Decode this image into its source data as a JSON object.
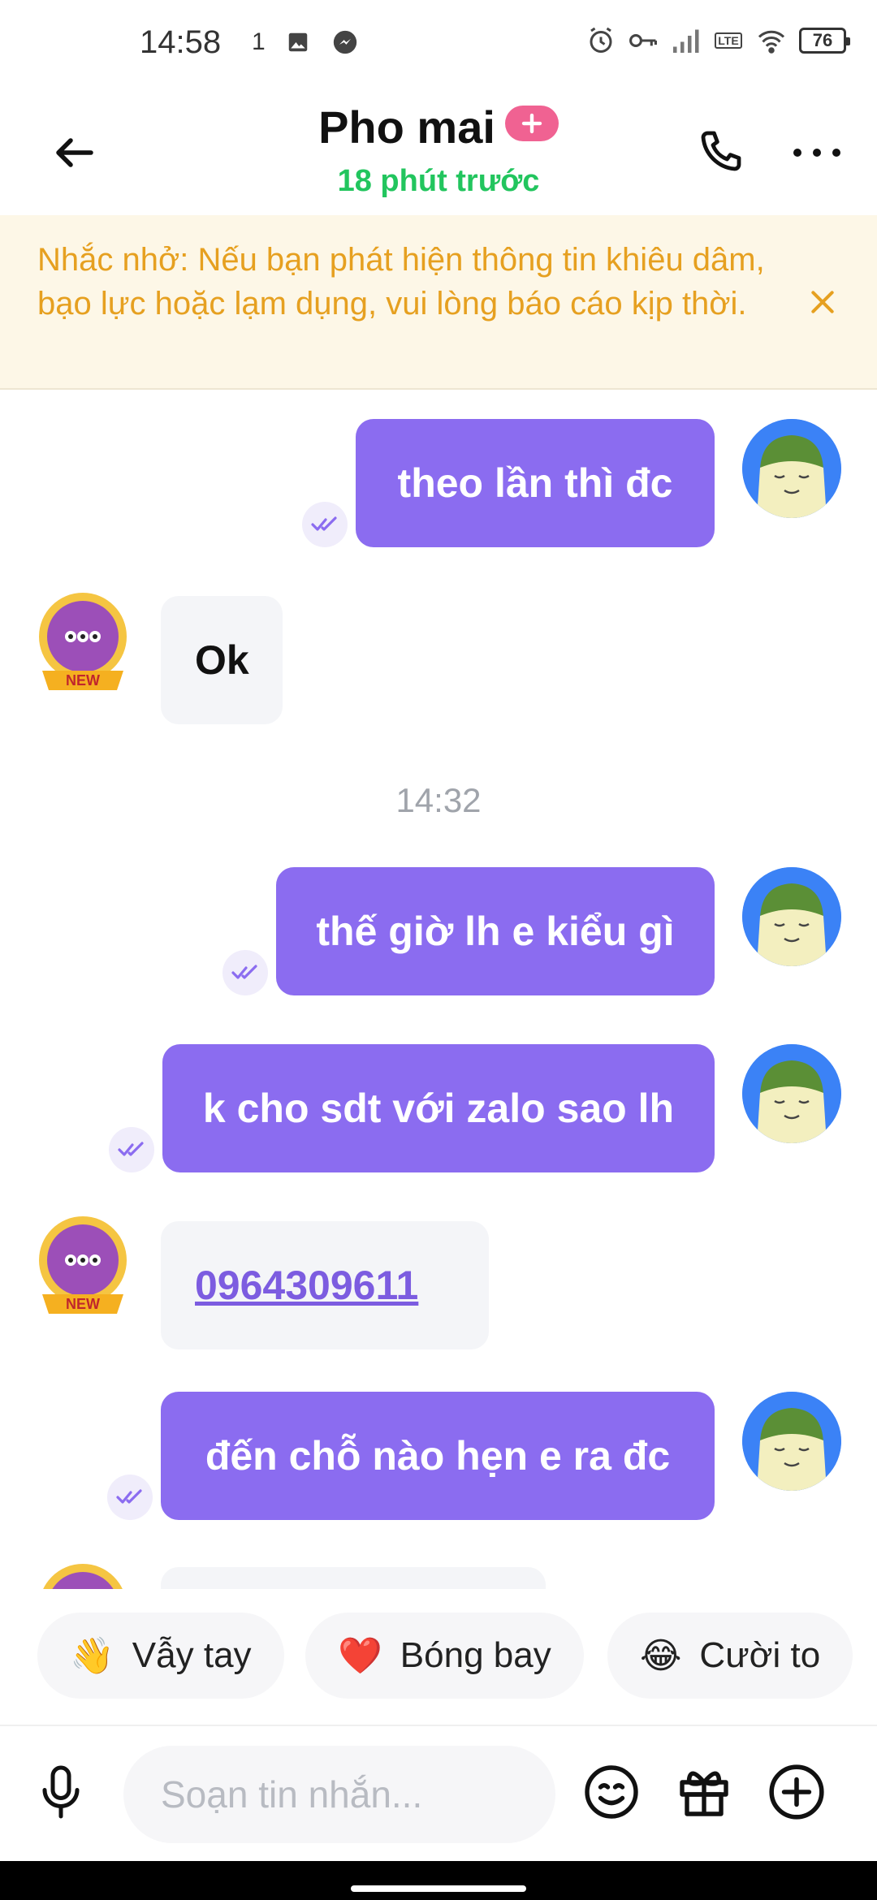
{
  "status_bar": {
    "time": "14:58",
    "extra_indicator": "1",
    "battery": "76",
    "icons": [
      "image-icon",
      "messenger-icon",
      "alarm-icon",
      "key-icon",
      "signal-icon",
      "volte-icon",
      "wifi-icon",
      "battery-icon"
    ],
    "volte_label": "LTE"
  },
  "header": {
    "title": "Pho mai",
    "subtitle": "18 phút trước",
    "badge_icon": "plus-icon",
    "accent_color": "#22c55e",
    "badge_color": "#f06292"
  },
  "notice": {
    "text": "Nhắc nhở: Nếu bạn phát hiện thông tin khiêu dâm, bạo lực hoặc lạm dụng, vui lòng báo cáo kịp thời.",
    "color": "#e6a020"
  },
  "messages": [
    {
      "side": "out",
      "text": "theo lần thì đc",
      "read": true
    },
    {
      "side": "in",
      "text": "Ok"
    },
    {
      "type": "timestamp",
      "text": "14:32"
    },
    {
      "side": "out",
      "text": "thế giờ lh e kiểu gì",
      "read": true
    },
    {
      "side": "out",
      "text": "k cho sdt với zalo sao lh",
      "read": true
    },
    {
      "side": "in",
      "text": "0964309611",
      "link": true
    },
    {
      "side": "out",
      "text": "đến chỗ nào hẹn e ra đc",
      "read": true
    }
  ],
  "avatar_badge": "NEW",
  "quick_replies": [
    {
      "emoji": "👋",
      "label": "Vẫy tay"
    },
    {
      "emoji": "❤️",
      "label": "Bóng bay"
    },
    {
      "emoji": "😂",
      "label": "Cười to"
    }
  ],
  "composer": {
    "placeholder": "Soạn tin nhắn...",
    "value": ""
  },
  "colors": {
    "bubble_out": "#8b6cf0",
    "bubble_in": "#f4f5f8",
    "link": "#7c5ce0"
  }
}
